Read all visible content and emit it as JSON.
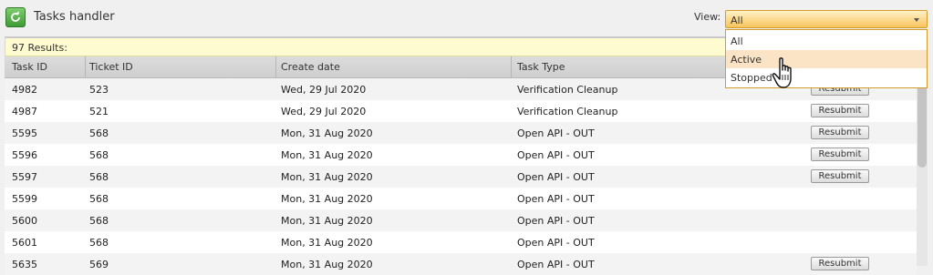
{
  "app": {
    "title": "Tasks handler"
  },
  "view": {
    "label": "View:",
    "selected": "All",
    "options": [
      "All",
      "Active",
      "Stopped"
    ],
    "hovered": "Active"
  },
  "results": {
    "text": "97 Results:"
  },
  "table": {
    "columns": [
      "Task ID",
      "Ticket ID",
      "Create date",
      "Task Type"
    ],
    "button_label": "Resubmit",
    "rows": [
      {
        "task_id": "4982",
        "ticket_id": "523",
        "create_date": "Wed, 29 Jul 2020",
        "task_type": "Verification Cleanup",
        "resubmit": true
      },
      {
        "task_id": "4987",
        "ticket_id": "521",
        "create_date": "Wed, 29 Jul 2020",
        "task_type": "Verification Cleanup",
        "resubmit": true
      },
      {
        "task_id": "5595",
        "ticket_id": "568",
        "create_date": "Mon, 31 Aug 2020",
        "task_type": "Open API - OUT",
        "resubmit": true
      },
      {
        "task_id": "5596",
        "ticket_id": "568",
        "create_date": "Mon, 31 Aug 2020",
        "task_type": "Open API - OUT",
        "resubmit": true
      },
      {
        "task_id": "5597",
        "ticket_id": "568",
        "create_date": "Mon, 31 Aug 2020",
        "task_type": "Open API - OUT",
        "resubmit": true
      },
      {
        "task_id": "5599",
        "ticket_id": "568",
        "create_date": "Mon, 31 Aug 2020",
        "task_type": "Open API - OUT",
        "resubmit": false
      },
      {
        "task_id": "5600",
        "ticket_id": "568",
        "create_date": "Mon, 31 Aug 2020",
        "task_type": "Open API - OUT",
        "resubmit": false
      },
      {
        "task_id": "5601",
        "ticket_id": "568",
        "create_date": "Mon, 31 Aug 2020",
        "task_type": "Open API - OUT",
        "resubmit": false
      },
      {
        "task_id": "5635",
        "ticket_id": "569",
        "create_date": "Mon, 31 Aug 2020",
        "task_type": "Open API - OUT",
        "resubmit": true
      }
    ]
  },
  "icons": {
    "refresh": "refresh-icon",
    "dropdown": "chevron-down-icon",
    "cursor": "hand-pointer-icon"
  },
  "colors": {
    "select_bg": "#f8c45c",
    "results_bg": "#fffbd0",
    "hover_item": "#fbe3c6",
    "refresh_green": "#3f9a35"
  }
}
